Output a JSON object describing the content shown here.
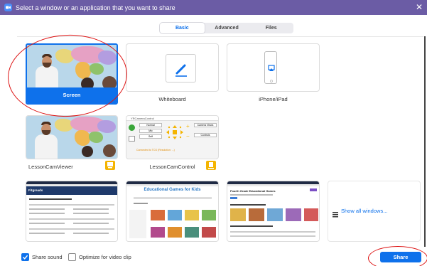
{
  "window": {
    "title": "Select a window or an application that you want to share",
    "close_glyph": "✕"
  },
  "tabs": [
    "Basic",
    "Advanced",
    "Files"
  ],
  "active_tab": "Basic",
  "tiles": {
    "screen": "Screen",
    "whiteboard": "Whiteboard",
    "iphone": "iPhone/iPad",
    "lessoncam_viewer": "LessonCamViewer",
    "lessoncam_control": "LessonCamControl",
    "show_all": "Show all windows..."
  },
  "lessoncam_control_window": {
    "title": "YRCameraControl",
    "buttons": [
      "Normal",
      "Mic",
      "Self",
      "Camera Views",
      "Controls"
    ],
    "status_text": "Connected to TCG (Resolution: ...)"
  },
  "web_pages": {
    "page1": {
      "brand": "Fitgreads"
    },
    "page2": {
      "heading": "Educational Games for Kids"
    },
    "page3": {
      "heading": "Fourth Grade Educational Games"
    }
  },
  "bottom_bar": {
    "share_sound": "Share sound",
    "share_sound_checked": true,
    "optimize_video": "Optimize for video clip",
    "optimize_video_checked": false,
    "share_button": "Share"
  },
  "colors": {
    "title_bar": "#6b5ca5",
    "accent_blue": "#0e71eb",
    "annotation_red": "#dd1111",
    "lesson_cam_orange": "#f4b400"
  }
}
